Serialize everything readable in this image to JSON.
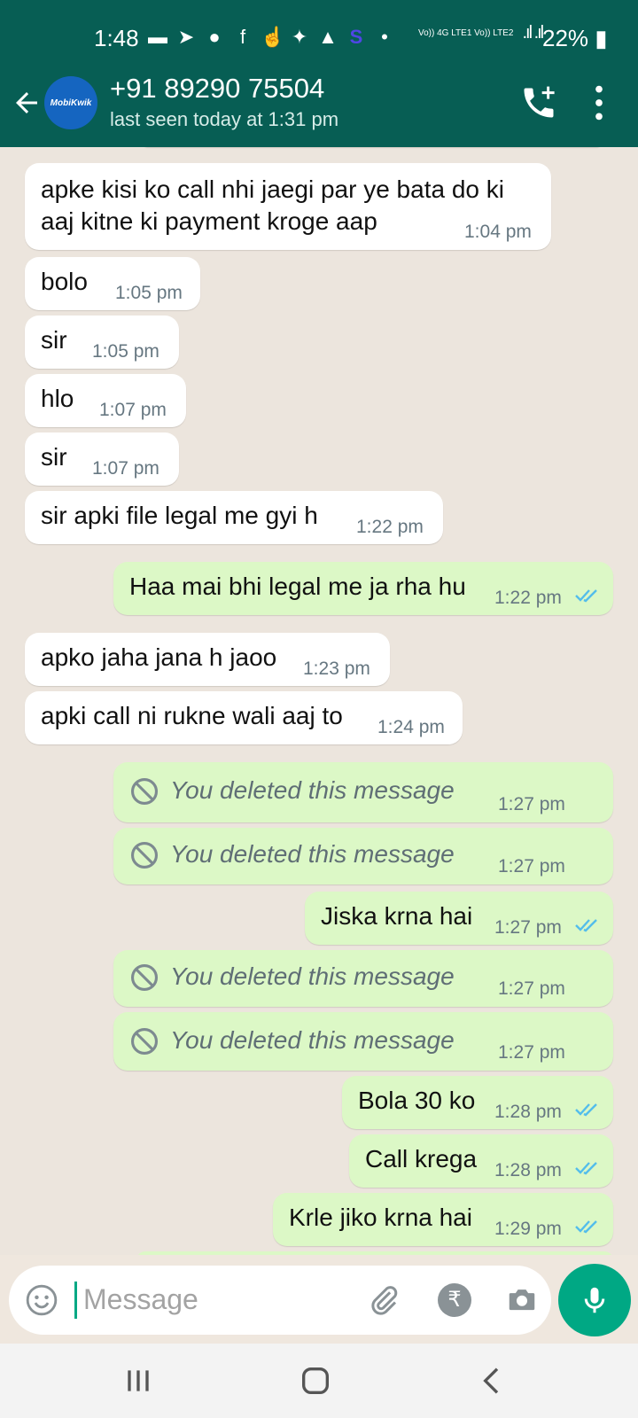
{
  "status_bar": {
    "time": "1:48",
    "network": "Vo)) 4G LTE1 Vo)) LTE2",
    "battery": "22%"
  },
  "header": {
    "contact_name": "+91 89290 75504",
    "last_seen": "last seen today at 1:31 pm",
    "avatar_text": "MobiKwik"
  },
  "messages": [
    {
      "dir": "in",
      "line1": "apke kisi ko call nhi jaegi par ye bata do ki",
      "line2": "aaj kitne ki payment kroge aap",
      "time": "1:04 pm"
    },
    {
      "dir": "in",
      "text": "bolo",
      "time": "1:05 pm"
    },
    {
      "dir": "in",
      "text": "sir",
      "time": "1:05 pm"
    },
    {
      "dir": "in",
      "text": "hlo",
      "time": "1:07 pm"
    },
    {
      "dir": "in",
      "text": "sir",
      "time": "1:07 pm"
    },
    {
      "dir": "in",
      "text": "sir apki file legal me gyi h",
      "time": "1:22 pm"
    },
    {
      "dir": "out",
      "text": "Haa mai bhi legal me ja rha hu",
      "time": "1:22 pm"
    },
    {
      "dir": "in",
      "text": "apko jaha jana h jaoo",
      "time": "1:23 pm"
    },
    {
      "dir": "in",
      "text": "apki call ni rukne wali aaj to",
      "time": "1:24 pm"
    },
    {
      "dir": "out",
      "deleted": true,
      "text": "You deleted this message",
      "time": "1:27 pm"
    },
    {
      "dir": "out",
      "deleted": true,
      "text": "You deleted this message",
      "time": "1:27 pm"
    },
    {
      "dir": "out",
      "text": "Jiska krna hai",
      "time": "1:27 pm"
    },
    {
      "dir": "out",
      "deleted": true,
      "text": "You deleted this message",
      "time": "1:27 pm"
    },
    {
      "dir": "out",
      "deleted": true,
      "text": "You deleted this message",
      "time": "1:27 pm"
    },
    {
      "dir": "out",
      "text": "Bola 30 ko",
      "time": "1:28 pm"
    },
    {
      "dir": "out",
      "text": "Call krega",
      "time": "1:28 pm"
    },
    {
      "dir": "out",
      "text": "Krle jiko krna hai",
      "time": "1:29 pm"
    }
  ],
  "input": {
    "placeholder": "Message",
    "rupee_symbol": "₹"
  },
  "colors": {
    "header_bg": "#075e54",
    "incoming_bubble": "#ffffff",
    "outgoing_bubble": "#dcf8c6",
    "accent": "#00a884",
    "read_ticks": "#53bdeb"
  }
}
